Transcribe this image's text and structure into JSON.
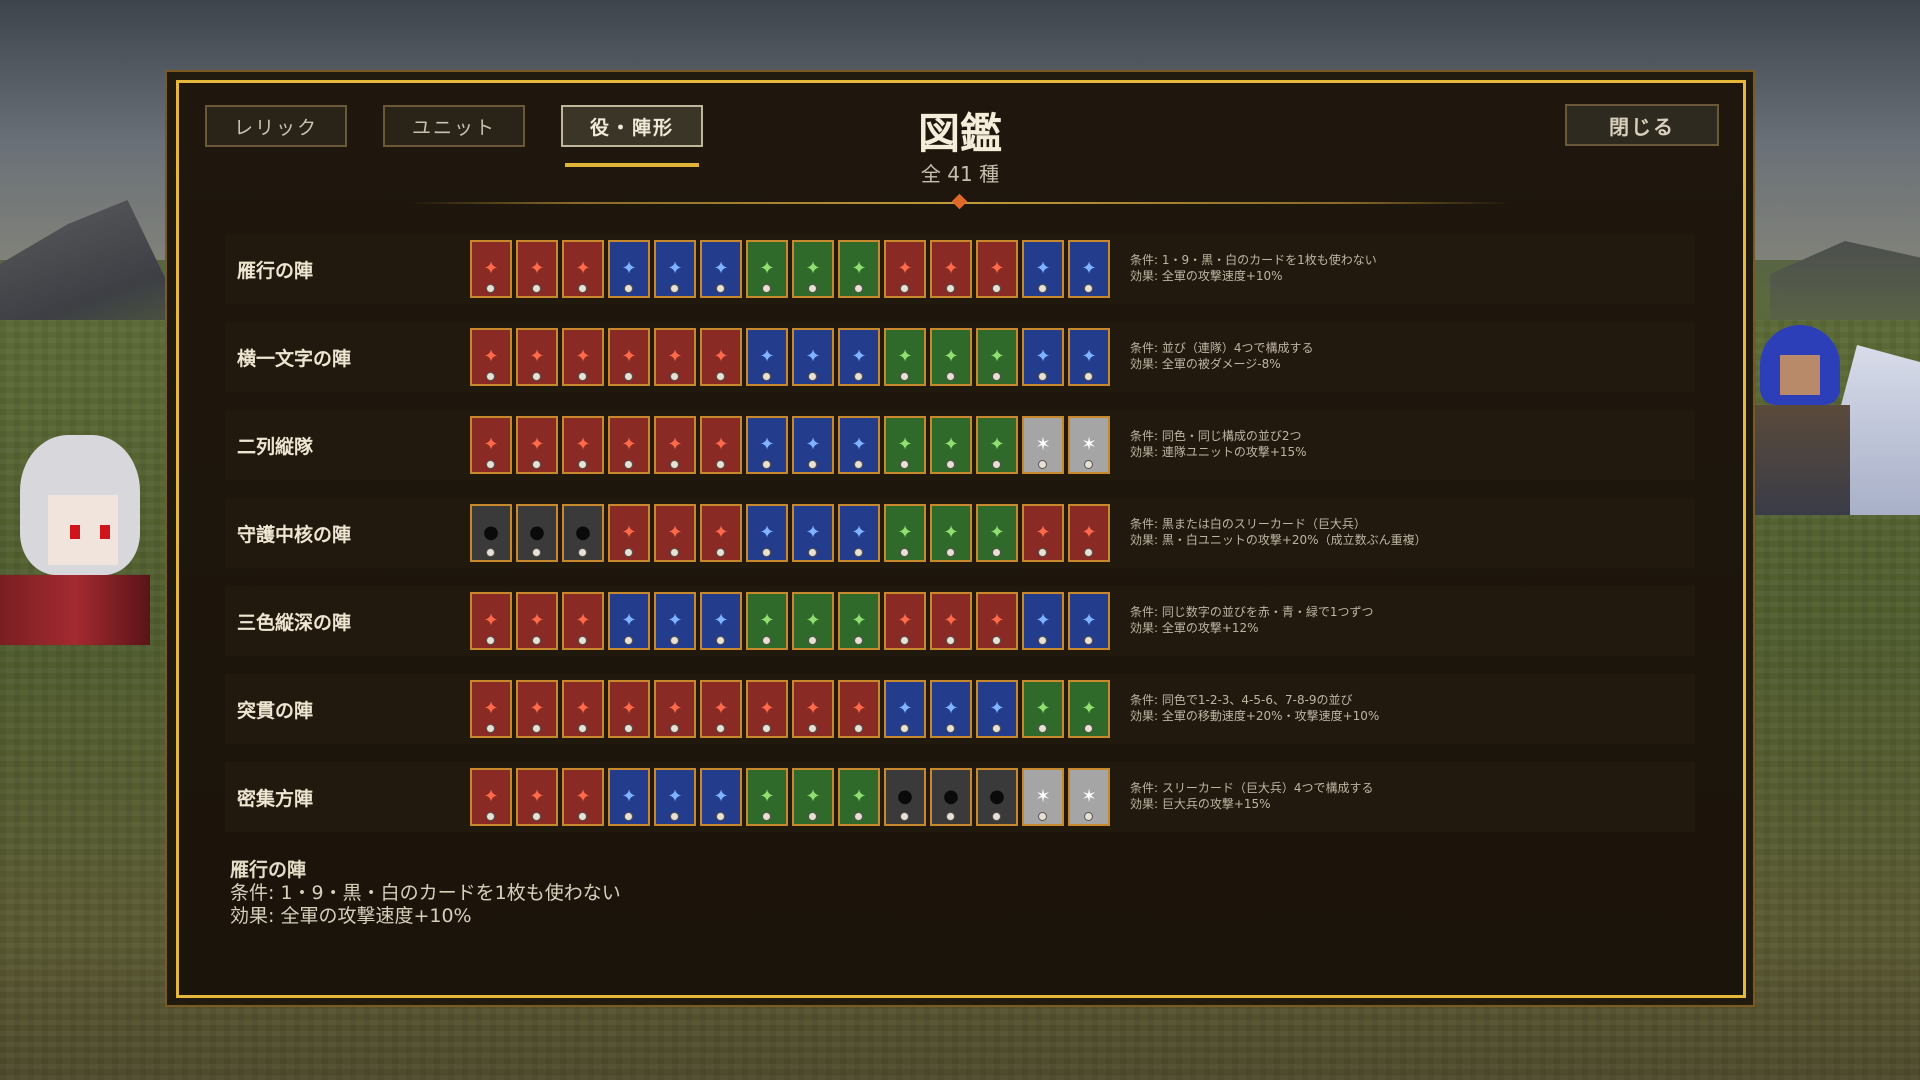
{
  "tabs": [
    {
      "label": "レリック"
    },
    {
      "label": "ユニット"
    },
    {
      "label": "役・陣形"
    }
  ],
  "header": {
    "title": "図鑑",
    "subtitle": "全 41 種"
  },
  "close_label": "閉じる",
  "formations": [
    {
      "name": "雁行の陣",
      "condition": "条件: 1・9・黒・白のカードを1枚も使わない",
      "effect": "効果: 全軍の攻撃速度+10%"
    },
    {
      "name": "横一文字の陣",
      "condition": "条件: 並び（連隊）4つで構成する",
      "effect": "効果: 全軍の被ダメージ-8%"
    },
    {
      "name": "二列縦隊",
      "condition": "条件: 同色・同じ構成の並び2つ",
      "effect": "効果: 連隊ユニットの攻撃+15%"
    },
    {
      "name": "守護中核の陣",
      "condition": "条件: 黒または白のスリーカード（巨大兵）",
      "effect": "効果: 黒・白ユニットの攻撃+20%（成立数ぶん重複）"
    },
    {
      "name": "三色縦深の陣",
      "condition": "条件: 同じ数字の並びを赤・青・緑で1つずつ",
      "effect": "効果: 全軍の攻撃+12%"
    },
    {
      "name": "突貫の陣",
      "condition": "条件: 同色で1-2-3、4-5-6、7-8-9の並び",
      "effect": "効果: 全軍の移動速度+20%・攻撃速度+10%"
    },
    {
      "name": "密集方陣",
      "condition": "条件: スリーカード（巨大兵）4つで構成する",
      "effect": "効果: 巨大兵の攻撃+15%"
    }
  ],
  "card_rows": [
    [
      "red",
      "red",
      "red",
      "blue",
      "blue",
      "blue",
      "green",
      "green",
      "green",
      "red",
      "red",
      "red",
      "blue",
      "blue"
    ],
    [
      "red",
      "red",
      "red",
      "red",
      "red",
      "red",
      "blue",
      "blue",
      "blue",
      "green",
      "green",
      "green",
      "blue",
      "blue"
    ],
    [
      "red",
      "red",
      "red",
      "red",
      "red",
      "red",
      "blue",
      "blue",
      "blue",
      "green",
      "green",
      "green",
      "white",
      "white"
    ],
    [
      "black",
      "black",
      "black",
      "red",
      "red",
      "red",
      "blue",
      "blue",
      "blue",
      "green",
      "green",
      "green",
      "red",
      "red"
    ],
    [
      "red",
      "red",
      "red",
      "blue",
      "blue",
      "blue",
      "green",
      "green",
      "green",
      "red",
      "red",
      "red",
      "blue",
      "blue"
    ],
    [
      "red",
      "red",
      "red",
      "red",
      "red",
      "red",
      "red",
      "red",
      "red",
      "blue",
      "blue",
      "blue",
      "green",
      "green"
    ],
    [
      "red",
      "red",
      "red",
      "blue",
      "blue",
      "blue",
      "green",
      "green",
      "green",
      "black",
      "black",
      "black",
      "white",
      "white"
    ]
  ],
  "detail": {
    "name": "雁行の陣",
    "condition": "条件: 1・9・黒・白のカードを1枚も使わない",
    "effect": "効果: 全軍の攻撃速度+10%"
  }
}
